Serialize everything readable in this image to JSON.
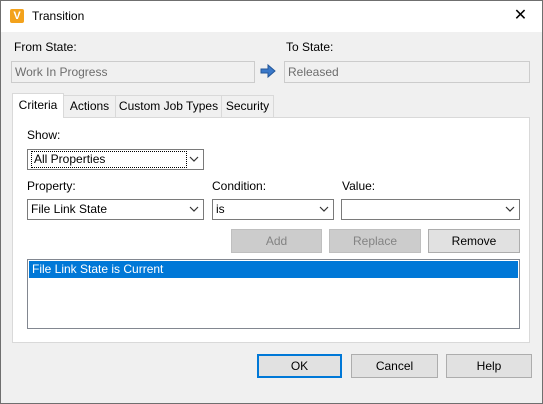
{
  "window": {
    "title": "Transition",
    "close_glyph": "✕",
    "app_icon": "V"
  },
  "from_state": {
    "label": "From State:",
    "value": "Work In Progress"
  },
  "to_state": {
    "label": "To State:",
    "value": "Released"
  },
  "arrow_icon": "arrow-right-icon",
  "tabs": [
    {
      "label": "Criteria",
      "active": true
    },
    {
      "label": "Actions"
    },
    {
      "label": "Custom Job Types"
    },
    {
      "label": "Security"
    }
  ],
  "criteria": {
    "show_label": "Show:",
    "show_value": "All Properties",
    "property_label": "Property:",
    "property_value": "File Link State",
    "condition_label": "Condition:",
    "condition_value": "is",
    "value_label": "Value:",
    "value_value": "",
    "buttons": {
      "add": "Add",
      "replace": "Replace",
      "remove": "Remove"
    },
    "list_items": [
      "File Link State is Current"
    ]
  },
  "footer": {
    "ok": "OK",
    "cancel": "Cancel",
    "help": "Help"
  },
  "colors": {
    "selection": "#0078d7",
    "accent_border": "#0078d7"
  }
}
